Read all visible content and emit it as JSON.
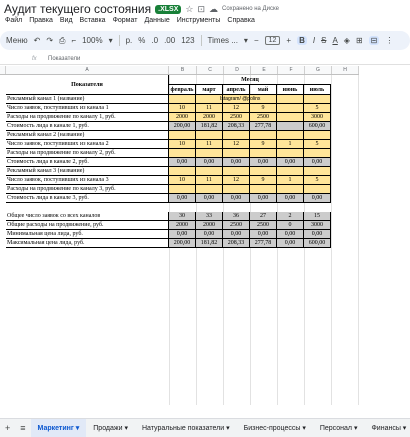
{
  "app": {
    "doc_title": "Аудит текущего состояния",
    "badge": ".XLSX",
    "saved_status": "Сохранено на Диске"
  },
  "menu": [
    "Файл",
    "Правка",
    "Вид",
    "Вставка",
    "Формат",
    "Данные",
    "Инструменты",
    "Справка"
  ],
  "toolbar": {
    "menus_label": "Меню",
    "zoom": "100%",
    "currency": "р.",
    "percent": "%",
    "dec_minus": ".0",
    "dec_plus": ".00",
    "format_123": "123",
    "font": "Times ...",
    "font_size": "12"
  },
  "formula_bar": {
    "cell_ref": "",
    "value": "Показатели"
  },
  "columns": [
    "",
    "A",
    "B",
    "C",
    "D",
    "E",
    "F",
    "G",
    "H"
  ],
  "sheet": {
    "header_main": "Показатели",
    "header_month": "Месяц",
    "months": [
      "февраль",
      "март",
      "апрель",
      "май",
      "июнь",
      "июль"
    ],
    "instagram": "Istagram/ @polinx",
    "rows": [
      {
        "label": "Рекламный канал 1 (название)",
        "vals": [
          "",
          "",
          "",
          "",
          "",
          ""
        ],
        "style": "yellow"
      },
      {
        "label": "Число заявок, поступивших из канала 1",
        "vals": [
          "10",
          "11",
          "12",
          "9",
          "",
          "5"
        ],
        "style": "yellow"
      },
      {
        "label": "Расходы на продвижение по каналу 1, руб.",
        "vals": [
          "2000",
          "2000",
          "2500",
          "2500",
          "",
          "3000"
        ],
        "style": "yellow"
      },
      {
        "label": "Стоимость лида в канале 1, руб.",
        "vals": [
          "200,00",
          "181,82",
          "208,33",
          "277,78",
          "",
          "600,00"
        ],
        "style": "gray"
      },
      {
        "label": "Рекламный канал 2 (название)",
        "vals": [
          "",
          "",
          "",
          "",
          "",
          ""
        ],
        "style": "yellow"
      },
      {
        "label": "Число заявок, поступивших из канала 2",
        "vals": [
          "10",
          "11",
          "12",
          "9",
          "1",
          "5"
        ],
        "style": "yellow"
      },
      {
        "label": "Расходы на продвижение по каналу 2, руб.",
        "vals": [
          "",
          "",
          "",
          "",
          "",
          ""
        ],
        "style": "yellow"
      },
      {
        "label": "Стоимость лида в канале 2, руб.",
        "vals": [
          "0,00",
          "0,00",
          "0,00",
          "0,00",
          "0,00",
          "0,00"
        ],
        "style": "gray"
      },
      {
        "label": "Рекламный канал 3 (название)",
        "vals": [
          "",
          "",
          "",
          "",
          "",
          ""
        ],
        "style": "yellow"
      },
      {
        "label": "Число заявок, поступивших из канала 3",
        "vals": [
          "10",
          "11",
          "12",
          "9",
          "1",
          "5"
        ],
        "style": "yellow"
      },
      {
        "label": "Расходы на продвижение по каналу 3, руб.",
        "vals": [
          "",
          "",
          "",
          "",
          "",
          ""
        ],
        "style": "yellow"
      },
      {
        "label": "Стоимость лида в канале 3, руб.",
        "vals": [
          "0,00",
          "0,00",
          "0,00",
          "0,00",
          "0,00",
          "0,00"
        ],
        "style": "gray"
      },
      {
        "label": "",
        "vals": [
          "",
          "",
          "",
          "",
          "",
          ""
        ],
        "style": "none"
      },
      {
        "label": "Общее число заявок со всех каналов",
        "vals": [
          "30",
          "33",
          "36",
          "27",
          "2",
          "15"
        ],
        "style": "gray"
      },
      {
        "label": "Общие расходы на продвижение, руб.",
        "vals": [
          "2000",
          "2000",
          "2500",
          "2500",
          "0",
          "3000"
        ],
        "style": "gray"
      },
      {
        "label": "Минимальная цена лида, руб.",
        "vals": [
          "0,00",
          "0,00",
          "0,00",
          "0,00",
          "0,00",
          "0,00"
        ],
        "style": "gray"
      },
      {
        "label": "Максимальная цена лида, руб.",
        "vals": [
          "200,00",
          "181,82",
          "208,33",
          "277,78",
          "0,00",
          "600,00"
        ],
        "style": "gray"
      }
    ]
  },
  "tabs": {
    "items": [
      "Маркетинг",
      "Продажи",
      "Натуральные показатели",
      "Бизнес-процессы",
      "Персонал",
      "Финансы"
    ],
    "active_index": 0
  }
}
